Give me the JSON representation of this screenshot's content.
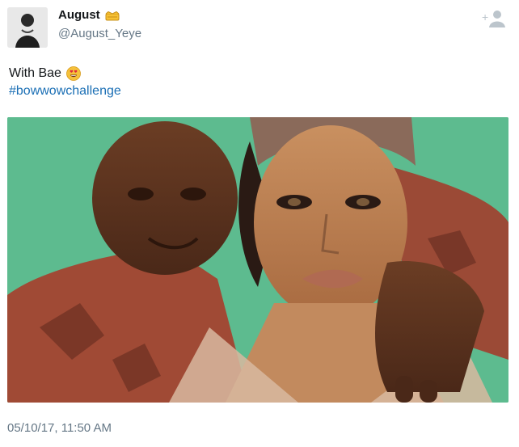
{
  "author": {
    "display_name": "August",
    "handle": "@August_Yeye",
    "badge_icon": "crown-emoji-icon"
  },
  "follow": {
    "icon": "add-user-icon",
    "color": "#bcc5cc"
  },
  "tweet": {
    "text": "With Bae",
    "emoji": "heart-eyes-emoji-icon",
    "hashtag": "#bowwowchallenge",
    "link_color": "#1b6fb5"
  },
  "media": {
    "background_color": "#5dbb8f"
  },
  "footer": {
    "timestamp": "05/10/17, 11:50 AM"
  }
}
